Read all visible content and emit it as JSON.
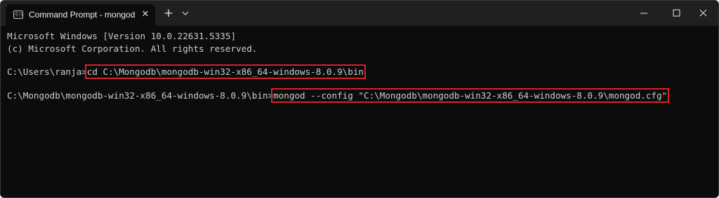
{
  "window": {
    "tab_title": "Command Prompt - mongod",
    "tab_close_glyph": "✕",
    "new_tab_glyph": "+",
    "controls": [
      "minimize",
      "maximize",
      "close"
    ]
  },
  "terminal": {
    "lines": [
      {
        "text": "Microsoft Windows [Version 10.0.22631.5335]"
      },
      {
        "text": "(c) Microsoft Corporation. All rights reserved."
      },
      {
        "prompt": "C:\\Users\\ranja>",
        "command": "cd C:\\Mongodb\\mongodb-win32-x86_64-windows-8.0.9\\bin"
      },
      {
        "prompt": "C:\\Mongodb\\mongodb-win32-x86_64-windows-8.0.9\\bin>",
        "command": "mongod --config \"C:\\Mongodb\\mongodb-win32-x86_64-windows-8.0.9\\mongod.cfg\""
      }
    ]
  },
  "colors": {
    "terminal_bg": "#0c0c0c",
    "titlebar_bg": "#202020",
    "text": "#cccccc",
    "highlight_border": "#d7222a"
  },
  "icons": {
    "tab_icon": "command-prompt-icon",
    "dropdown": "chevron-down-icon",
    "minimize": "minimize-icon",
    "maximize": "maximize-icon",
    "close": "close-icon"
  }
}
